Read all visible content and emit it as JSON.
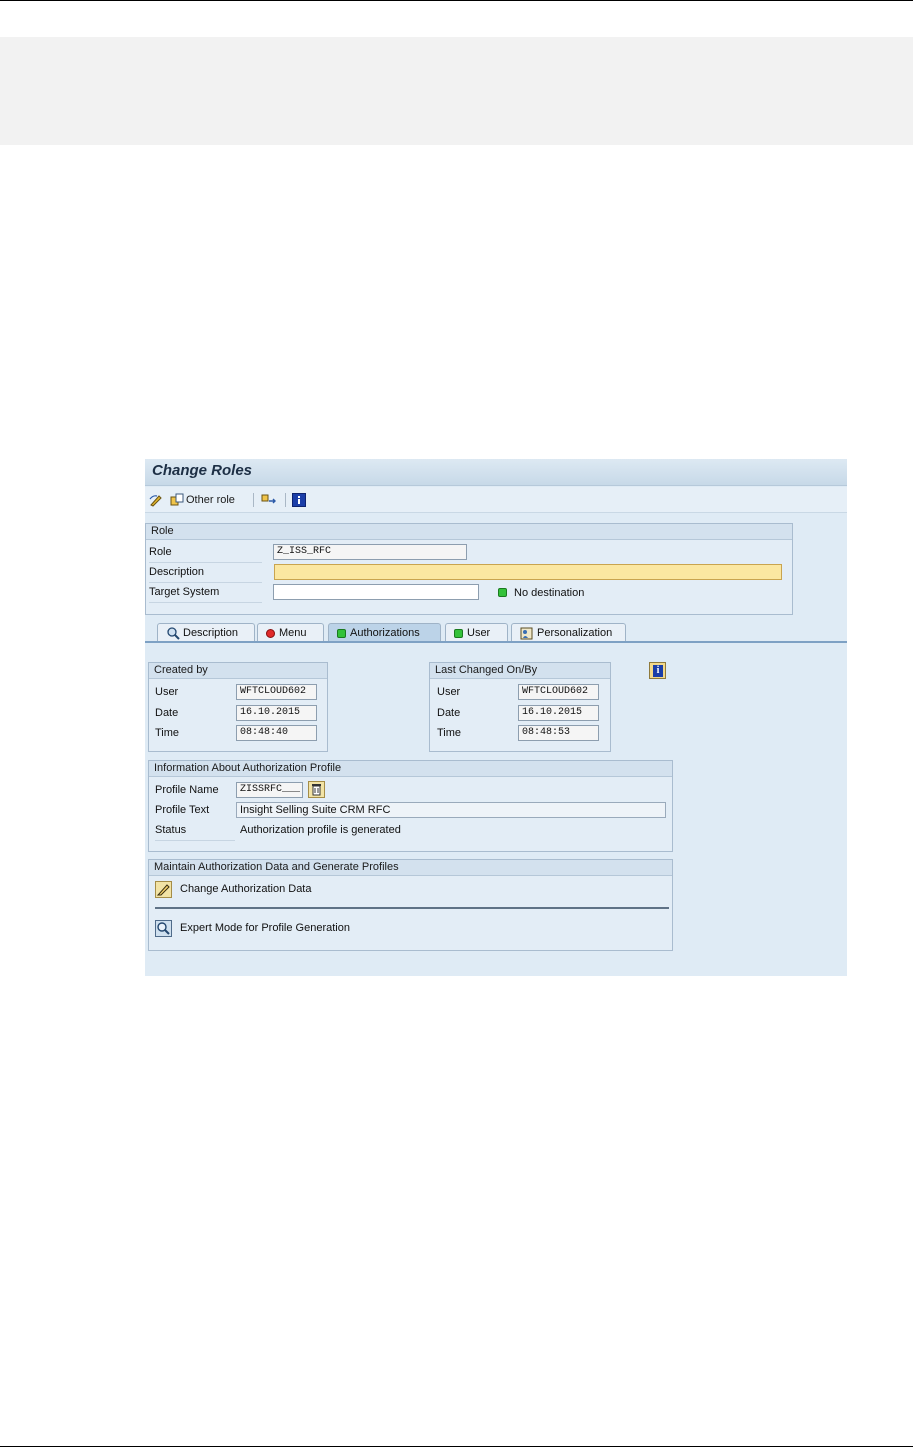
{
  "window": {
    "title": "Change Roles"
  },
  "toolbar": {
    "other_role_label": "Other role",
    "icons": [
      "display-change-icon",
      "other-role-icon",
      "transport-icon",
      "info-icon"
    ]
  },
  "role_section": {
    "title": "Role",
    "role_label": "Role",
    "role_value": "Z_ISS_RFC",
    "description_label": "Description",
    "description_value": "",
    "target_system_label": "Target System",
    "target_system_value": "",
    "status_text": "No destination",
    "status_color": "#34c23a"
  },
  "tabs": [
    {
      "label": "Description",
      "icon": "magnifier-icon",
      "active": false
    },
    {
      "label": "Menu",
      "icon": "red-led-icon",
      "active": false
    },
    {
      "label": "Authorizations",
      "icon": "green-led-icon",
      "active": true
    },
    {
      "label": "User",
      "icon": "green-led-icon",
      "active": false
    },
    {
      "label": "Personalization",
      "icon": "personalization-icon",
      "active": false
    }
  ],
  "created_by": {
    "title": "Created by",
    "user_label": "User",
    "user_value": "WFTCLOUD602",
    "date_label": "Date",
    "date_value": "16.10.2015",
    "time_label": "Time",
    "time_value": "08:48:40"
  },
  "last_changed": {
    "title": "Last Changed On/By",
    "user_label": "User",
    "user_value": "WFTCLOUD602",
    "date_label": "Date",
    "date_value": "16.10.2015",
    "time_label": "Time",
    "time_value": "08:48:53"
  },
  "auth_profile": {
    "title": "Information About Authorization Profile",
    "profile_name_label": "Profile Name",
    "profile_name_value": "ZISSRFC___",
    "profile_text_label": "Profile Text",
    "profile_text_value": "Insight Selling Suite CRM RFC",
    "status_label": "Status",
    "status_value": "Authorization profile is generated"
  },
  "maintain": {
    "title": "Maintain Authorization Data and Generate Profiles",
    "change_auth_label": "Change Authorization Data",
    "expert_mode_label": "Expert Mode for Profile Generation"
  },
  "colors": {
    "window_bg": "#dfebf5",
    "title_text": "#1d2f45",
    "active_tab": "#bcd3e8",
    "required_field": "#fbe7a1"
  }
}
